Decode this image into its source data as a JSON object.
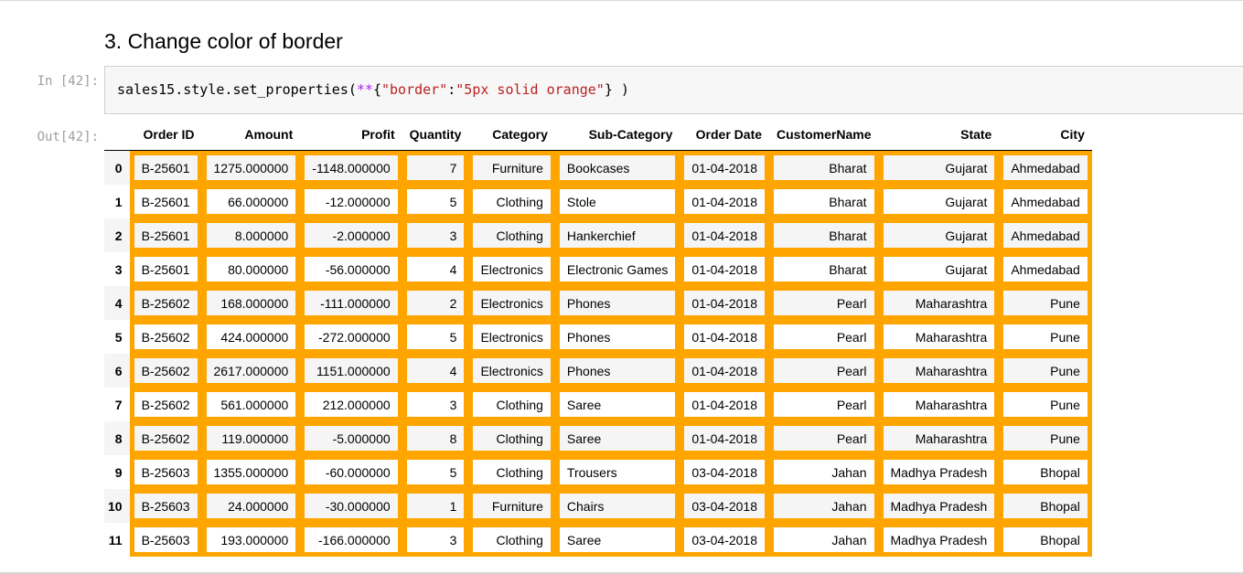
{
  "section_heading": "3. Change color of border",
  "input_prompt": "In [42]:",
  "output_prompt": "Out[42]:",
  "code": {
    "obj": "sales15",
    "dot1": ".",
    "attr1": "style",
    "dot2": ".",
    "method": "set_properties",
    "lparen": "(",
    "op": "**",
    "lbrace": "{",
    "key": "\"border\"",
    "colon": ":",
    "value": "\"5px solid orange\"",
    "rbrace": "}",
    "rparen": " )"
  },
  "table": {
    "columns": [
      "Order ID",
      "Amount",
      "Profit",
      "Quantity",
      "Category",
      "Sub-Category",
      "Order Date",
      "CustomerName",
      "State",
      "City"
    ],
    "index": [
      "0",
      "1",
      "2",
      "3",
      "4",
      "5",
      "6",
      "7",
      "8",
      "9",
      "10",
      "11"
    ],
    "rows": [
      [
        "B-25601",
        "1275.000000",
        "-1148.000000",
        "7",
        "Furniture",
        "Bookcases",
        "01-04-2018",
        "Bharat",
        "Gujarat",
        "Ahmedabad"
      ],
      [
        "B-25601",
        "66.000000",
        "-12.000000",
        "5",
        "Clothing",
        "Stole",
        "01-04-2018",
        "Bharat",
        "Gujarat",
        "Ahmedabad"
      ],
      [
        "B-25601",
        "8.000000",
        "-2.000000",
        "3",
        "Clothing",
        "Hankerchief",
        "01-04-2018",
        "Bharat",
        "Gujarat",
        "Ahmedabad"
      ],
      [
        "B-25601",
        "80.000000",
        "-56.000000",
        "4",
        "Electronics",
        "Electronic Games",
        "01-04-2018",
        "Bharat",
        "Gujarat",
        "Ahmedabad"
      ],
      [
        "B-25602",
        "168.000000",
        "-111.000000",
        "2",
        "Electronics",
        "Phones",
        "01-04-2018",
        "Pearl",
        "Maharashtra",
        "Pune"
      ],
      [
        "B-25602",
        "424.000000",
        "-272.000000",
        "5",
        "Electronics",
        "Phones",
        "01-04-2018",
        "Pearl",
        "Maharashtra",
        "Pune"
      ],
      [
        "B-25602",
        "2617.000000",
        "1151.000000",
        "4",
        "Electronics",
        "Phones",
        "01-04-2018",
        "Pearl",
        "Maharashtra",
        "Pune"
      ],
      [
        "B-25602",
        "561.000000",
        "212.000000",
        "3",
        "Clothing",
        "Saree",
        "01-04-2018",
        "Pearl",
        "Maharashtra",
        "Pune"
      ],
      [
        "B-25602",
        "119.000000",
        "-5.000000",
        "8",
        "Clothing",
        "Saree",
        "01-04-2018",
        "Pearl",
        "Maharashtra",
        "Pune"
      ],
      [
        "B-25603",
        "1355.000000",
        "-60.000000",
        "5",
        "Clothing",
        "Trousers",
        "03-04-2018",
        "Jahan",
        "Madhya Pradesh",
        "Bhopal"
      ],
      [
        "B-25603",
        "24.000000",
        "-30.000000",
        "1",
        "Furniture",
        "Chairs",
        "03-04-2018",
        "Jahan",
        "Madhya Pradesh",
        "Bhopal"
      ],
      [
        "B-25603",
        "193.000000",
        "-166.000000",
        "3",
        "Clothing",
        "Saree",
        "03-04-2018",
        "Jahan",
        "Madhya Pradesh",
        "Bhopal"
      ]
    ]
  },
  "colors": {
    "cell_border": "#ffa500",
    "code_background": "#f7f7f7",
    "prompt_text": "#9e9e9e",
    "code_operator": "#aa22ff",
    "code_string": "#ba2121"
  }
}
